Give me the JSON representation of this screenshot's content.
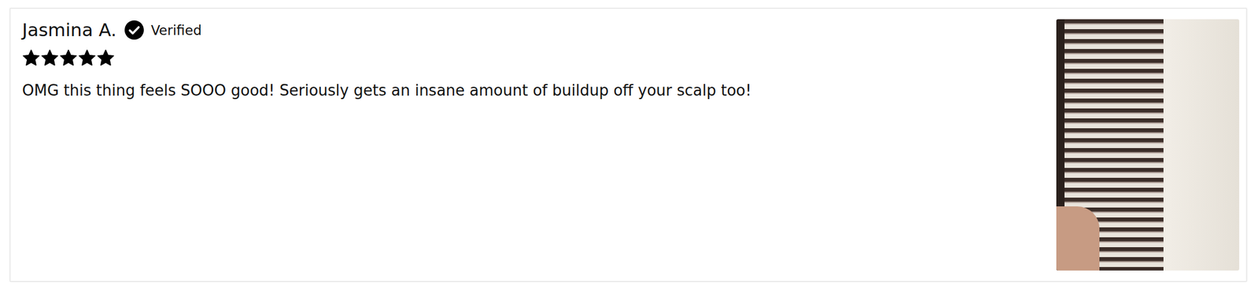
{
  "review": {
    "reviewer": "Jasmina A.",
    "verified_label": "Verified",
    "verified": true,
    "stars": 5,
    "text": "OMG this thing feels SOOO good! Seriously gets an insane amount of buildup off your scalp too!"
  }
}
